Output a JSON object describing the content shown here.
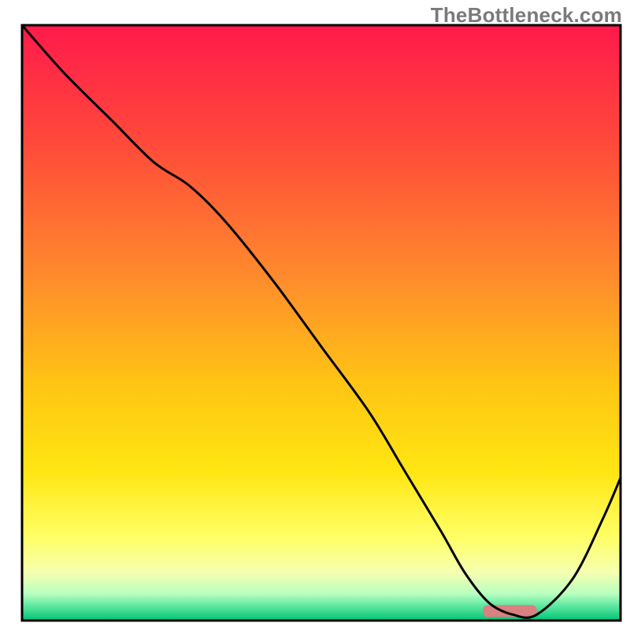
{
  "watermark": {
    "text": "TheBottleneck.com"
  },
  "chart_data": {
    "type": "line",
    "title": "",
    "xlabel": "",
    "ylabel": "",
    "xlim": [
      0,
      100
    ],
    "ylim": [
      0,
      100
    ],
    "grid": false,
    "legend": false,
    "background_gradient_stops": [
      {
        "offset": 0.0,
        "color": "#ff1a4b"
      },
      {
        "offset": 0.2,
        "color": "#ff4a3a"
      },
      {
        "offset": 0.42,
        "color": "#ff8a2d"
      },
      {
        "offset": 0.6,
        "color": "#ffc414"
      },
      {
        "offset": 0.75,
        "color": "#ffe612"
      },
      {
        "offset": 0.86,
        "color": "#ffff66"
      },
      {
        "offset": 0.92,
        "color": "#f5ffb0"
      },
      {
        "offset": 0.955,
        "color": "#b8ffc0"
      },
      {
        "offset": 0.975,
        "color": "#5fe8a0"
      },
      {
        "offset": 1.0,
        "color": "#00c477"
      }
    ],
    "series": [
      {
        "name": "bottleneck-curve",
        "stroke": "#000000",
        "x": [
          0,
          7,
          15,
          22,
          28,
          34,
          42,
          50,
          58,
          64,
          70,
          74,
          78,
          82,
          86,
          92,
          97,
          100
        ],
        "y": [
          100,
          92,
          84,
          77,
          73,
          67,
          57,
          46,
          35,
          25,
          15,
          8,
          3,
          1,
          1,
          7,
          17,
          24
        ]
      }
    ],
    "marker": {
      "name": "optimal-band",
      "color": "#d98080",
      "x_start": 77,
      "x_end": 86,
      "y": 0.6,
      "height": 2.0
    }
  }
}
